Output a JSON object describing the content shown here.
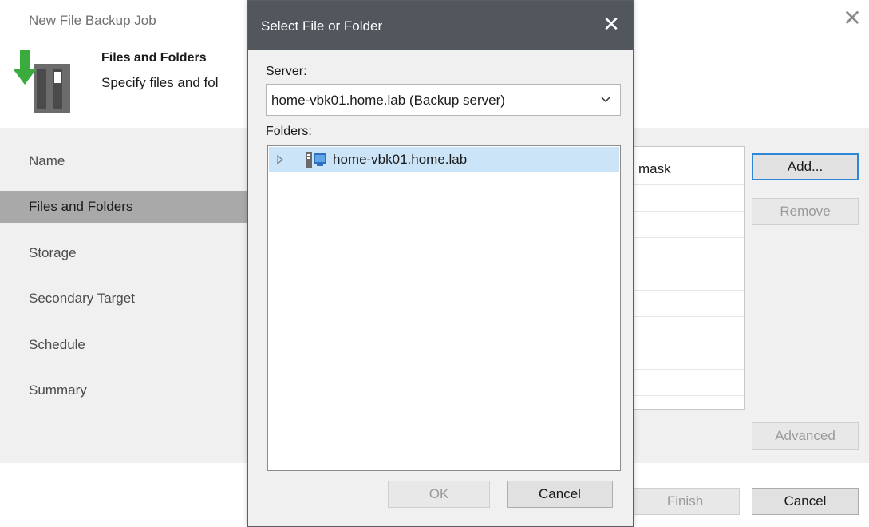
{
  "wizard": {
    "title": "New File Backup Job",
    "header_title": "Files and Folders",
    "header_subtitle": "Specify files and fol",
    "steps": [
      {
        "label": "Name"
      },
      {
        "label": "Files and Folders"
      },
      {
        "label": "Storage"
      },
      {
        "label": "Secondary Target"
      },
      {
        "label": "Schedule"
      },
      {
        "label": "Summary"
      }
    ],
    "active_step": "Files and Folders",
    "list_header_fragment": "mask",
    "buttons": {
      "add": "Add...",
      "remove": "Remove",
      "advanced": "Advanced",
      "finish": "Finish",
      "cancel": "Cancel"
    }
  },
  "dialog": {
    "title": "Select File or Folder",
    "server_label": "Server:",
    "server_value": "home-vbk01.home.lab (Backup server)",
    "folders_label": "Folders:",
    "tree": [
      {
        "label": "home-vbk01.home.lab",
        "selected": true,
        "expandable": true
      }
    ],
    "buttons": {
      "ok": "OK",
      "cancel": "Cancel"
    }
  },
  "icons": {
    "wizard_close": "close-icon",
    "dialog_close": "close-icon",
    "server_dropdown": "chevron-down-icon",
    "tree_expand": "chevron-right-icon",
    "tree_node": "server-icon",
    "header": "file-backup-icon"
  },
  "colors": {
    "titlebar": "#52575e",
    "active_step": "#a9a9a9",
    "selection": "#cce4f7",
    "primary_border": "#2f86d6",
    "brand_green": "#3aab3c"
  }
}
